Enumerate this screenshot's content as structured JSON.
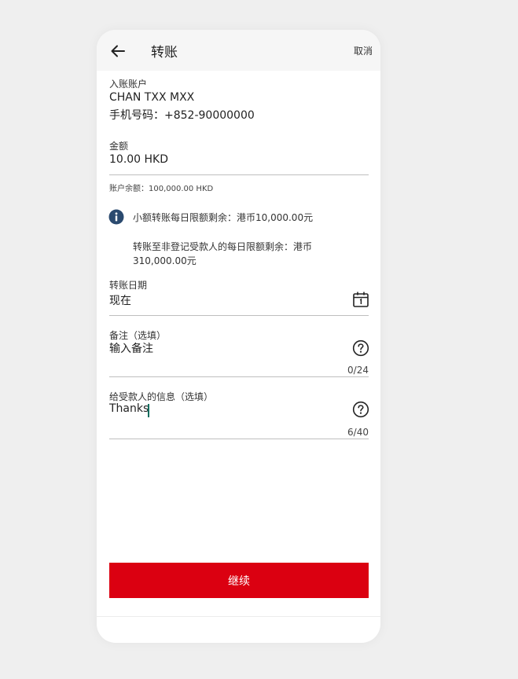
{
  "header": {
    "title": "转账",
    "cancel_label": "取消"
  },
  "payee": {
    "label": "入账账户",
    "name": "CHAN TXX MXX",
    "phone": "手机号码：+852-90000000"
  },
  "amount": {
    "label": "金额",
    "value": "10.00 HKD",
    "balance": "账户余额：100,000.00 HKD"
  },
  "notice": {
    "line1": "小额转账每日限额剩余：港币10,000.00元",
    "line2": "转账至非登记受款人的每日限额剩余：港币310,000.00元"
  },
  "transfer_date": {
    "label": "转账日期",
    "value": "现在"
  },
  "remark": {
    "label": "备注（选填）",
    "placeholder": "输入备注",
    "counter": "0/24"
  },
  "message": {
    "label": "给受款人的信息（选填）",
    "value": "Thanks",
    "counter": "6/40"
  },
  "footer": {
    "continue_label": "继续"
  },
  "colors": {
    "primary_button": "#db0011",
    "info_icon": "#2b4a6f",
    "caret": "#0a6d5e"
  },
  "icons": {
    "back": "arrow-left-icon",
    "info": "info-circle-icon",
    "calendar": "calendar-icon",
    "help": "question-circle-icon"
  }
}
